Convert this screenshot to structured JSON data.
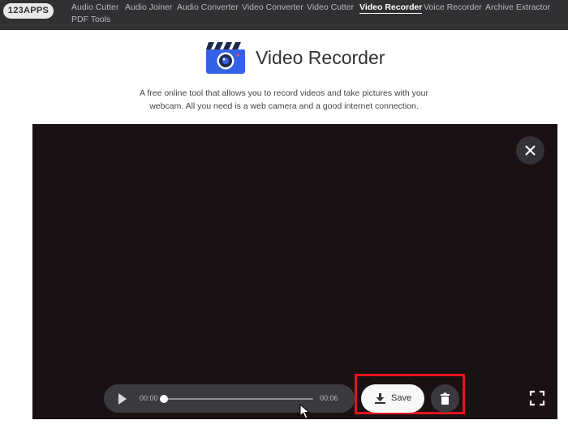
{
  "nav": {
    "logo": "123APPS",
    "links": [
      "Audio Cutter",
      "Audio Joiner",
      "Audio Converter",
      "Video Converter",
      "Video Cutter",
      "Video Recorder",
      "Voice Recorder",
      "Archive Extractor",
      "PDF Tools"
    ],
    "active": "Video Recorder"
  },
  "header": {
    "icon": "video-recorder-app-icon",
    "title": "Video Recorder",
    "description": "A free online tool that allows you to record videos and take pictures with your webcam. All you need is a web camera and a good internet connection."
  },
  "player": {
    "current_time": "00:00",
    "total_time": "00:06",
    "progress": 0,
    "save_label": "Save"
  },
  "icons": {
    "close": "close-icon",
    "play": "play-icon",
    "download": "download-icon",
    "delete": "trash-icon",
    "fullscreen": "fullscreen-icon"
  },
  "colors": {
    "navbar": "#303133",
    "video_background": "#1a1113",
    "highlight": "#e5141c",
    "app_icon": "#3561e6"
  }
}
